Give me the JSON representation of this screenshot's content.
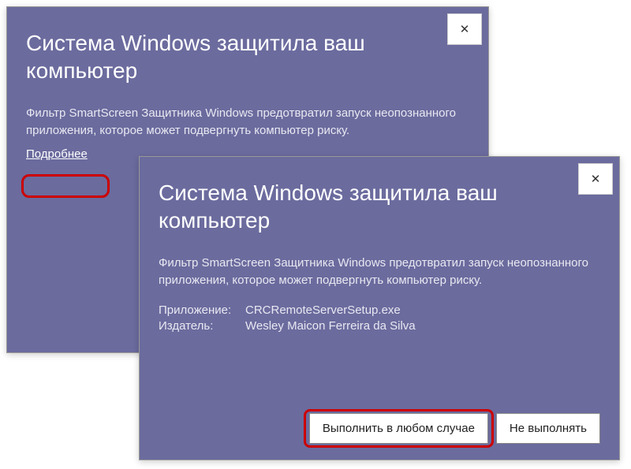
{
  "dialog1": {
    "title": "Система Windows защитила ваш компьютер",
    "body": "Фильтр SmartScreen Защитника Windows предотвратил запуск неопознанного приложения, которое может подвергнуть компьютер риску.",
    "more_link": "Подробнее",
    "close_symbol": "✕"
  },
  "dialog2": {
    "title": "Система Windows защитила ваш компьютер",
    "body": "Фильтр SmartScreen Защитника Windows предотвратил запуск неопознанного приложения, которое может подвергнуть компьютер риску.",
    "close_symbol": "✕",
    "app_label": "Приложение:",
    "app_value": "CRCRemoteServerSetup.exe",
    "publisher_label": "Издатель:",
    "publisher_value": "Wesley Maicon Ferreira da Silva",
    "run_anyway": "Выполнить в любом случае",
    "dont_run": "Не выполнять"
  },
  "colors": {
    "dialog_bg": "#6B6B9E",
    "highlight": "#CC0000"
  }
}
